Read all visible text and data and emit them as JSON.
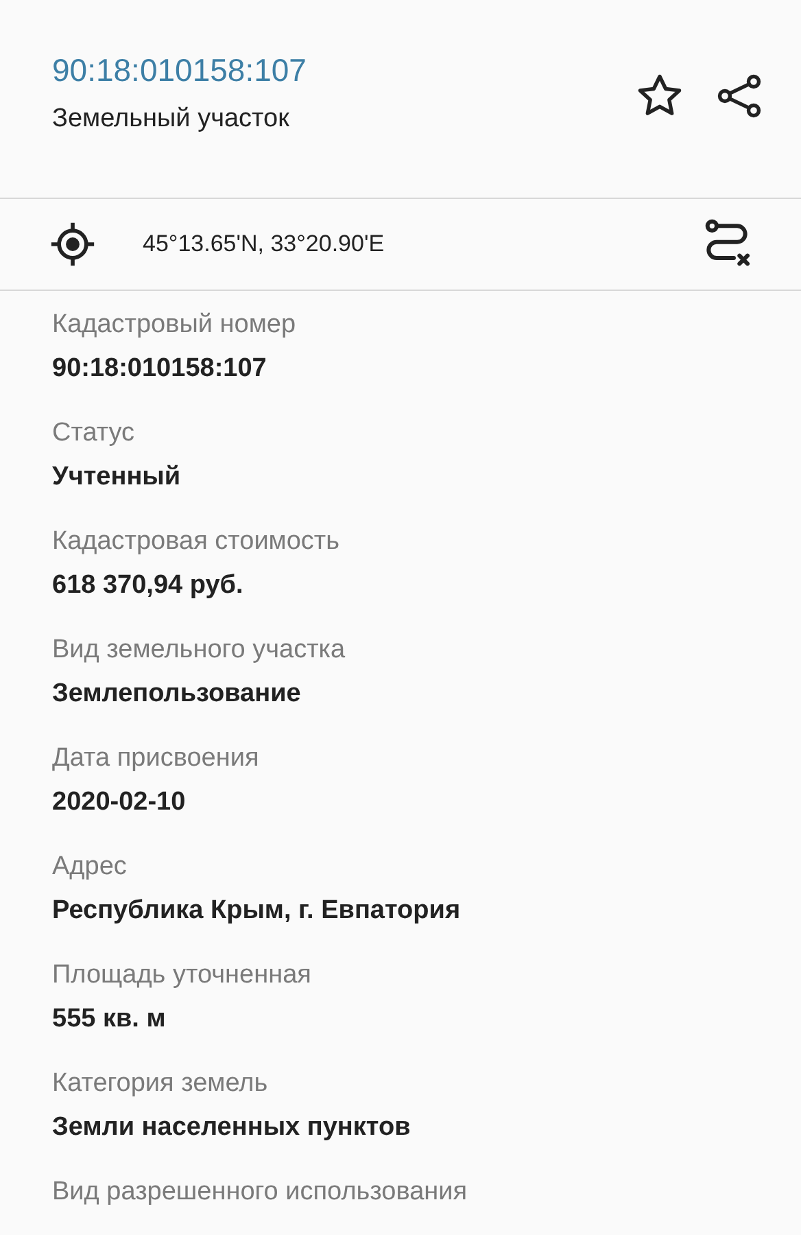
{
  "header": {
    "title": "90:18:010158:107",
    "subtitle": "Земельный участок"
  },
  "coordinates": "45°13.65'N, 33°20.90'E",
  "fields": [
    {
      "label": "Кадастровый номер",
      "value": "90:18:010158:107"
    },
    {
      "label": "Статус",
      "value": "Учтенный"
    },
    {
      "label": "Кадастровая стоимость",
      "value": "618 370,94 руб."
    },
    {
      "label": "Вид земельного участка",
      "value": "Землепользование"
    },
    {
      "label": "Дата присвоения",
      "value": "2020-02-10"
    },
    {
      "label": "Адрес",
      "value": "Республика Крым, г. Евпатория"
    },
    {
      "label": "Площадь уточненная",
      "value": "555 кв. м"
    },
    {
      "label": "Категория земель",
      "value": "Земли населенных пунктов"
    },
    {
      "label": "Вид разрешенного использования"
    }
  ]
}
